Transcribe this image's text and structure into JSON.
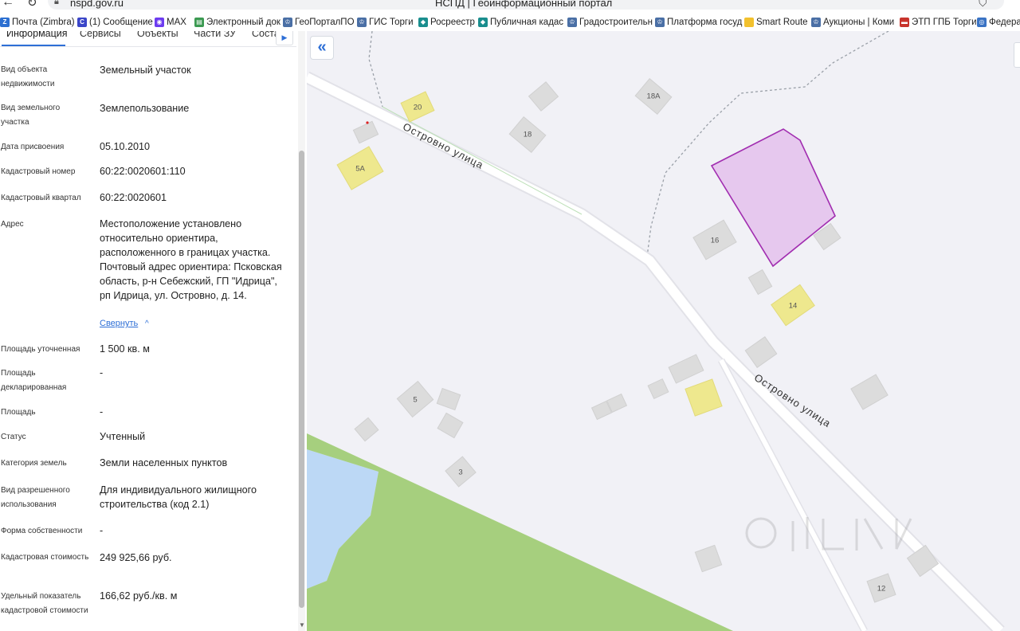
{
  "browser": {
    "url": "nspd.gov.ru",
    "title": "НСПД | Геоинформационный портал"
  },
  "bookmarks": [
    {
      "label": "Почта (Zimbra)",
      "icon": "zimbra-icon",
      "color": "#2c6fd1",
      "glyph": "Z"
    },
    {
      "label": "(1) Сообщение",
      "icon": "message-icon",
      "color": "#3b46c8",
      "glyph": "С"
    },
    {
      "label": "MAX",
      "icon": "max-icon",
      "color": "#6d3cf0",
      "glyph": "◉"
    },
    {
      "label": "Электронный док",
      "icon": "document-icon",
      "color": "#3c9a52",
      "glyph": "▤"
    },
    {
      "label": "ГеоПорталПО",
      "icon": "emblem-icon",
      "color": "#4a6fa5",
      "glyph": "♔"
    },
    {
      "label": "ГИС Торги",
      "icon": "emblem-icon",
      "color": "#4a6fa5",
      "glyph": "♔"
    },
    {
      "label": "Росреестр",
      "icon": "rosreestr-icon",
      "color": "#1a8e8e",
      "glyph": "◆"
    },
    {
      "label": "Публичная кадас",
      "icon": "map-icon",
      "color": "#1a8e8e",
      "glyph": "◆"
    },
    {
      "label": "Градостроительн",
      "icon": "emblem-icon",
      "color": "#4a6fa5",
      "glyph": "♔"
    },
    {
      "label": "Платформа госуд",
      "icon": "eagle-icon",
      "color": "#4a6fa5",
      "glyph": "♔"
    },
    {
      "label": "Smart Route",
      "icon": "folder-icon",
      "color": "#f2c12e",
      "glyph": ""
    },
    {
      "label": "Аукционы | Коми",
      "icon": "emblem-icon",
      "color": "#4a6fa5",
      "glyph": "♔"
    },
    {
      "label": "ЭТП ГПБ Торги",
      "icon": "flag-icon",
      "color": "#c8342c",
      "glyph": "▬"
    },
    {
      "label": "Федера",
      "icon": "globe-icon",
      "color": "#3a73c4",
      "glyph": "◎"
    }
  ],
  "tabs": [
    "Информация",
    "Сервисы",
    "Объекты",
    "Части ЗУ",
    "Соста"
  ],
  "info": {
    "object_type_label": "Вид объекта недвижимости",
    "object_type": "Земельный участок",
    "parcel_type_label": "Вид земельного участка",
    "parcel_type": "Землепользование",
    "assign_date_label": "Дата присвоения",
    "assign_date": "05.10.2010",
    "cad_number_label": "Кадастровый номер",
    "cad_number": "60:22:0020601:110",
    "cad_quarter_label": "Кадастровый квартал",
    "cad_quarter": "60:22:0020601",
    "address_label": "Адрес",
    "address": "Местоположение установлено относительно ориентира, расположенного в границах участка. Почтовый адрес ориентира: Псковская область, р-н Себежский, ГП \"Идрица\", рп Идрица, ул. Островно, д. 14.",
    "collapse_link": "Свернуть",
    "area_precise_label": "Площадь уточненная",
    "area_precise": "1 500 кв. м",
    "area_declared_label": "Площадь декларированная",
    "area_declared": "-",
    "area_label": "Площадь",
    "area": "-",
    "status_label": "Статус",
    "status": "Учтенный",
    "land_category_label": "Категория земель",
    "land_category": "Земли населенных пунктов",
    "permitted_use_label": "Вид разрешенного использования",
    "permitted_use": "Для индивидуального жилищного строительства (код 2.1)",
    "ownership_label": "Форма собственности",
    "ownership": "-",
    "cad_value_label": "Кадастровая стоимость",
    "cad_value": "249 925,66 руб.",
    "specific_value_label": "Удельный показатель кадастровой стоимости",
    "specific_value": "166,62 руб./кв. м"
  },
  "map": {
    "street_1": "Островно улица",
    "street_2": "Островно улица",
    "houses": [
      "20",
      "18А",
      "18",
      "5А",
      "16",
      "14",
      "5",
      "3",
      "12"
    ],
    "colors": {
      "background": "#f1f1f6",
      "road": "#ffffff",
      "building": "#dcdcdc",
      "highlight_building": "#eee88e",
      "parcel_fill": "#e6c8ee",
      "parcel_stroke": "#a12db0",
      "green": "#a6cf7e",
      "water": "#bcd8f5"
    }
  }
}
